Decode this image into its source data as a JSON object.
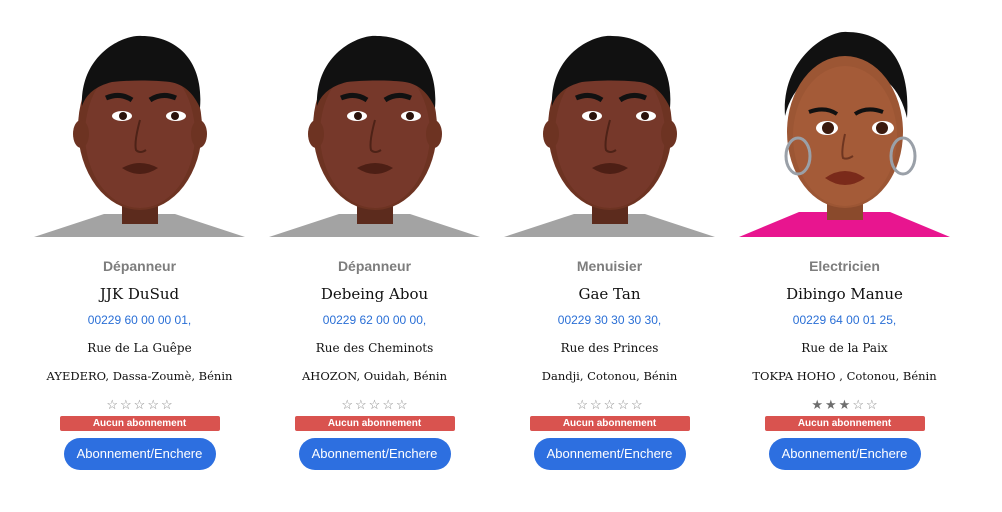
{
  "cards": [
    {
      "trade": "Dépanneur",
      "name": "JJK DuSud",
      "phone": "00229 60 00 00 01,",
      "street": "Rue de La Guêpe",
      "city": "AYEDERO, Dassa-Zoumè, Bénin",
      "rating": 0,
      "badge": "Aucun abonnement",
      "button": "Abonnement/Enchere",
      "avatar": "male-avatar"
    },
    {
      "trade": "Dépanneur",
      "name": "Debeing Abou",
      "phone": "00229 62 00 00 00,",
      "street": "Rue des Cheminots",
      "city": "AHOZON, Ouidah, Bénin",
      "rating": 0,
      "badge": "Aucun abonnement",
      "button": "Abonnement/Enchere",
      "avatar": "male-avatar"
    },
    {
      "trade": "Menuisier",
      "name": "Gae Tan",
      "phone": "00229 30 30 30 30,",
      "street": "Rue des Princes",
      "city": "Dandji, Cotonou, Bénin",
      "rating": 0,
      "badge": "Aucun abonnement",
      "button": "Abonnement/Enchere",
      "avatar": "male-avatar"
    },
    {
      "trade": "Electricien",
      "name": "Dibingo Manue",
      "phone": "00229 64 00 01 25,",
      "street": "Rue de la Paix",
      "city": "TOKPA HOHO , Cotonou, Bénin",
      "rating": 3,
      "badge": "Aucun abonnement",
      "button": "Abonnement/Enchere",
      "avatar": "female-avatar"
    }
  ],
  "colors": {
    "badge": "#d9534f",
    "button": "#2d6fe0",
    "phone": "#2a6fd6",
    "male_shirt": "#a3a3a3",
    "female_shirt": "#e8158f"
  }
}
